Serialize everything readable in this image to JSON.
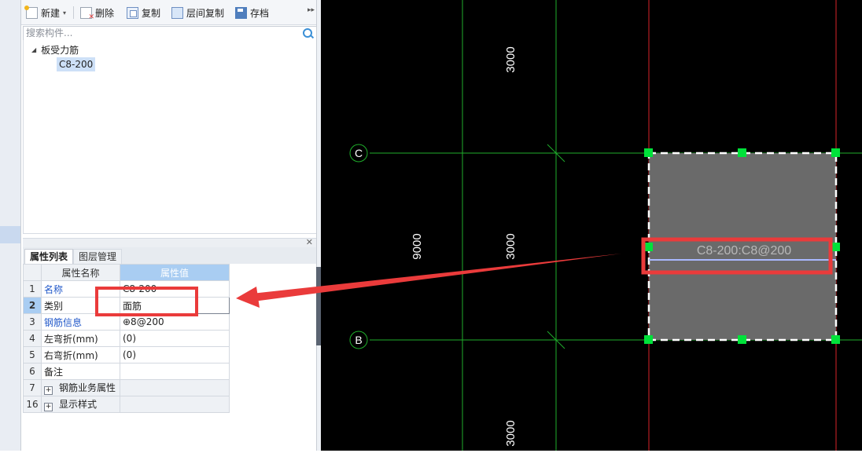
{
  "toolbar": {
    "new_label": "新建",
    "delete_label": "删除",
    "copy_label": "复制",
    "floor_copy_label": "层间复制",
    "save_label": "存档",
    "more_glyph": "▸▸"
  },
  "search": {
    "placeholder": "搜索构件..."
  },
  "tree": {
    "root_label": "板受力筋",
    "child_label": "C8-200"
  },
  "tabs": {
    "properties_label": "属性列表",
    "layers_label": "图层管理"
  },
  "table": {
    "header_name": "属性名称",
    "header_value": "属性值",
    "rows": [
      {
        "num": "1",
        "name": "名称",
        "value": "C8-200"
      },
      {
        "num": "2",
        "name": "类别",
        "value": "面筋"
      },
      {
        "num": "3",
        "name": "钢筋信息",
        "value": "⊕8@200"
      },
      {
        "num": "4",
        "name": "左弯折(mm)",
        "value": "(0)"
      },
      {
        "num": "5",
        "name": "右弯折(mm)",
        "value": "(0)"
      },
      {
        "num": "6",
        "name": "备注",
        "value": ""
      },
      {
        "num": "7",
        "name": "钢筋业务属性",
        "value": ""
      },
      {
        "num": "16",
        "name": "显示样式",
        "value": ""
      }
    ]
  },
  "canvas": {
    "axis_c": "C",
    "axis_b": "B",
    "dim_top": "3000",
    "dim_mid": "3000",
    "dim_bottom": "3000",
    "dim_total": "9000",
    "slab_label": "C8-200:C8@200"
  },
  "colors": {
    "grid_green": "#1fae2b",
    "grid_red": "#d8232a",
    "slab_fill": "#6a6a6a",
    "handle_green": "#00e23a",
    "annotation_red": "#ea3b3b",
    "rebar_blue": "#a9b8ff"
  }
}
